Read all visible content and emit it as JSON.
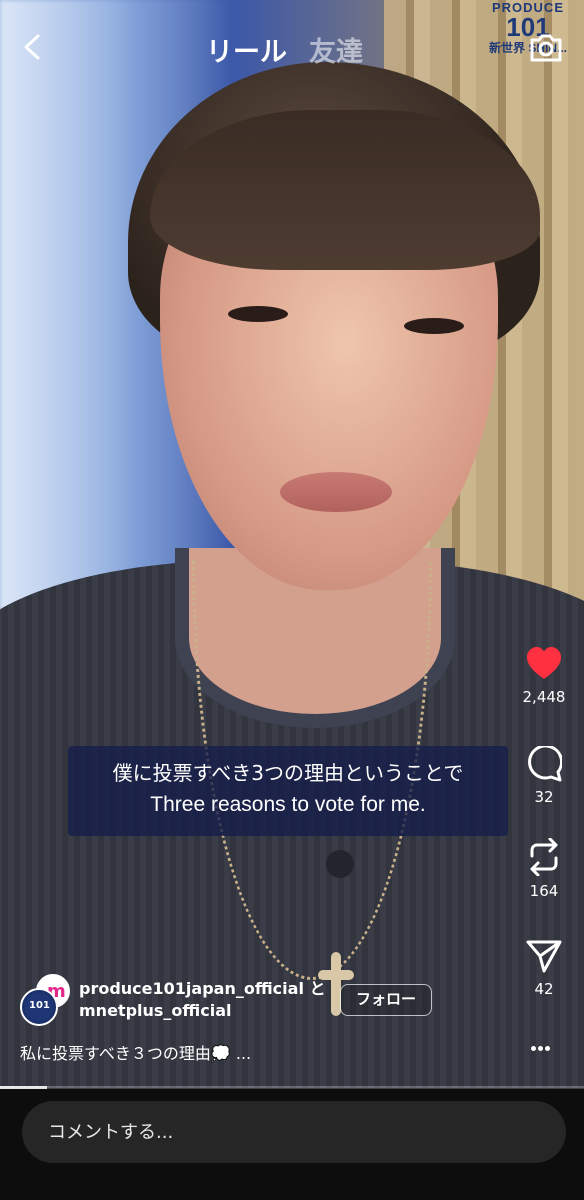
{
  "header": {
    "tabs": [
      {
        "label": "リール",
        "active": true
      },
      {
        "label": "友達",
        "active": false
      }
    ],
    "back_icon": "chevron-left-icon",
    "camera_icon": "camera-icon"
  },
  "brand": {
    "line1": "PRODUCE",
    "line2": "101",
    "line3": "新世界 SHIN..."
  },
  "subtitle": {
    "japanese": "僕に投票すべき3つの理由ということで",
    "english": "Three reasons to vote for me."
  },
  "actions": {
    "likes": "2,448",
    "comments": "32",
    "reposts": "164",
    "shares": "42",
    "like_color": "#ff3040"
  },
  "author": {
    "line1": "produce101japan_official と",
    "line2": "mnetplus_official",
    "avatar_text": "101",
    "avatar2_text": "m",
    "follow_label": "フォロー"
  },
  "caption": "私に投票すべき３つの理由💭 ...",
  "progress": 0.08,
  "comment": {
    "placeholder": "コメントする..."
  }
}
